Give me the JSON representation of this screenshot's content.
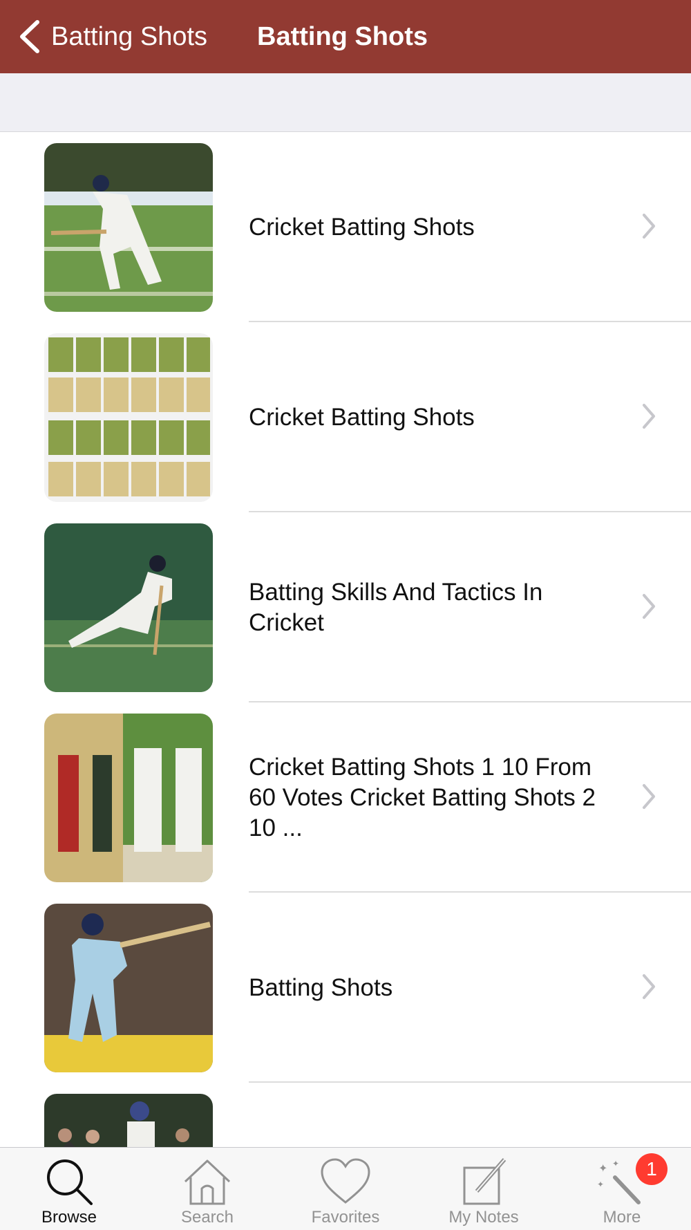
{
  "nav": {
    "back_label": "Batting Shots",
    "title": "Batting Shots",
    "back_icon": "chevron-left-icon"
  },
  "list": {
    "items": [
      {
        "title": "Cricket Batting Shots"
      },
      {
        "title": "Cricket Batting Shots"
      },
      {
        "title": "Batting Skills And Tactics In Cricket"
      },
      {
        "title": "Cricket Batting Shots 1 10 From 60 Votes Cricket Batting Shots 2 10 ..."
      },
      {
        "title": "Batting Shots"
      },
      {
        "title": ""
      }
    ]
  },
  "tabbar": {
    "tabs": [
      {
        "label": "Browse",
        "icon": "search-icon",
        "active": true
      },
      {
        "label": "Search",
        "icon": "home-icon"
      },
      {
        "label": "Favorites",
        "icon": "heart-icon"
      },
      {
        "label": "My Notes",
        "icon": "pencil-note-icon"
      },
      {
        "label": "More",
        "icon": "magic-wand-icon",
        "badge": "1"
      }
    ]
  },
  "colors": {
    "nav_bg": "#923a32",
    "badge": "#ff3b30"
  }
}
